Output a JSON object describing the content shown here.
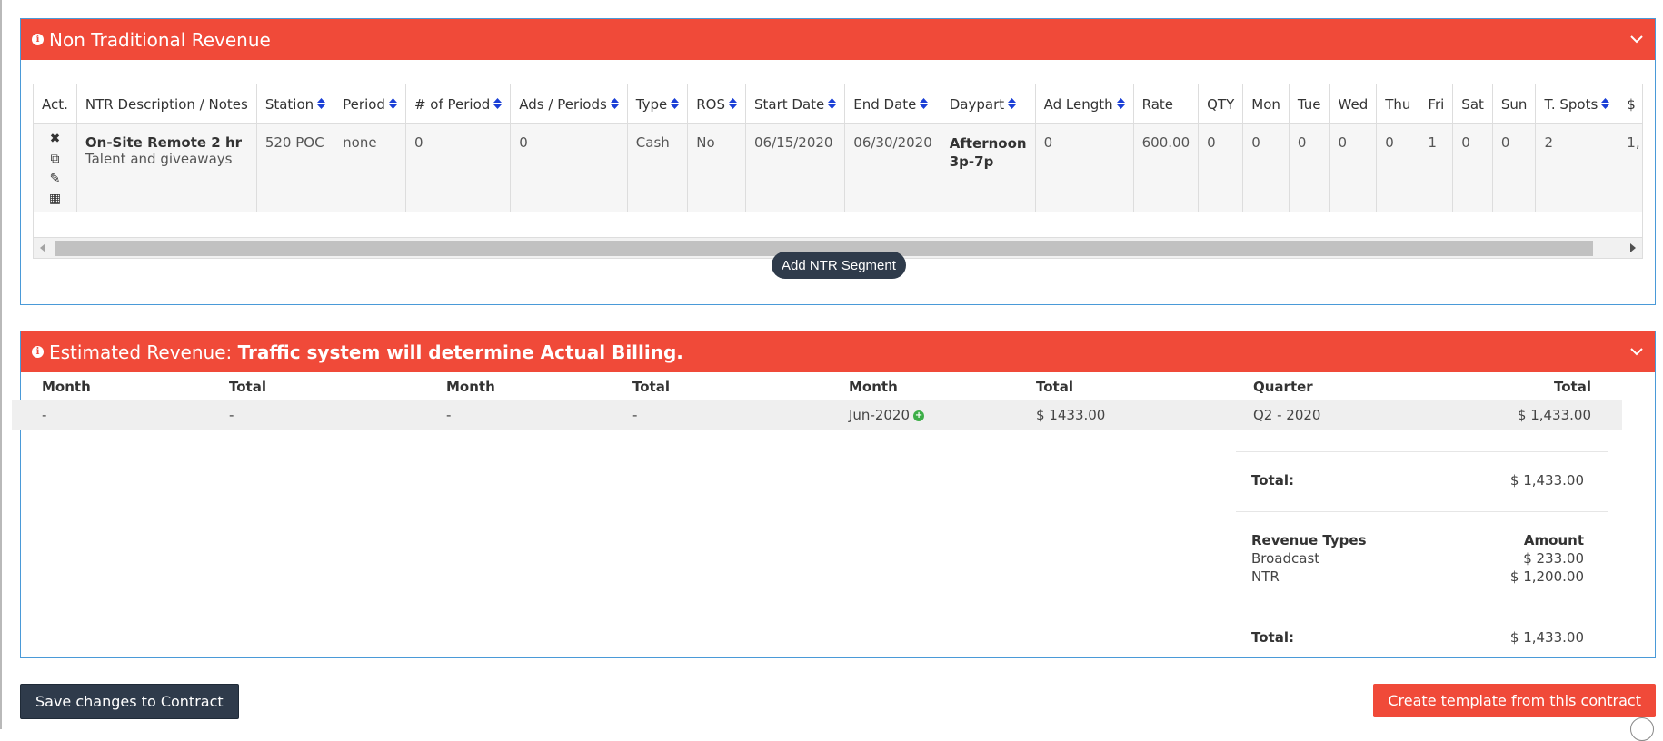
{
  "colors": {
    "header_bg": "#f04a39",
    "panel_border": "#4a9ad8",
    "dark_button": "#2f3b4b",
    "sort_icon": "#1a3fd6",
    "add_icon": "#3cae47"
  },
  "ntr_panel": {
    "title": "Non Traditional Revenue",
    "columns": [
      "Act.",
      "NTR Description / Notes",
      "Station",
      "Period",
      "# of Period",
      "Ads / Periods",
      "Type",
      "ROS",
      "Start Date",
      "End Date",
      "Daypart",
      "Ad Length",
      "Rate",
      "QTY",
      "Mon",
      "Tue",
      "Wed",
      "Thu",
      "Fri",
      "Sat",
      "Sun",
      "T. Spots",
      "$"
    ],
    "row": {
      "desc_title": "On-Site Remote 2 hr",
      "desc_notes": "Talent and giveaways",
      "station": "520 POC",
      "period": "none",
      "num_period": "0",
      "ads_periods": "0",
      "type": "Cash",
      "ros": "No",
      "start_date": "06/15/2020",
      "end_date": "06/30/2020",
      "daypart_line1": "Afternoon",
      "daypart_line2": "3p-7p",
      "ad_length": "0",
      "rate": "600.00",
      "qty": "0",
      "mon": "0",
      "tue": "0",
      "wed": "0",
      "thu": "0",
      "fri": "1",
      "sat": "0",
      "sun": "0",
      "t_spots": "2",
      "dollar": "1,"
    },
    "add_button": "Add NTR Segment"
  },
  "est_panel": {
    "title_prefix": "Estimated Revenue:",
    "title_bold": "Traffic system will determine Actual Billing.",
    "headers": {
      "month1": "Month",
      "total1": "Total",
      "month2": "Month",
      "total2": "Total",
      "month3": "Month",
      "total3": "Total",
      "quarter": "Quarter",
      "qtotal": "Total"
    },
    "row": {
      "month1": "-",
      "total1": "-",
      "month2": "-",
      "total2": "-",
      "month3": "Jun-2020",
      "total3": "$ 1433.00",
      "quarter": "Q2 - 2020",
      "qtotal": "$ 1,433.00"
    },
    "total_label": "Total:",
    "total_value": "$ 1,433.00",
    "revenue_types": {
      "header_label": "Revenue Types",
      "header_amount": "Amount",
      "items": [
        {
          "label": "Broadcast",
          "amount": "$ 233.00"
        },
        {
          "label": "NTR",
          "amount": "$ 1,200.00"
        }
      ]
    },
    "grand_total_label": "Total:",
    "grand_total_value": "$ 1,433.00"
  },
  "footer": {
    "save_label": "Save changes to Contract",
    "template_label": "Create template from this contract"
  }
}
